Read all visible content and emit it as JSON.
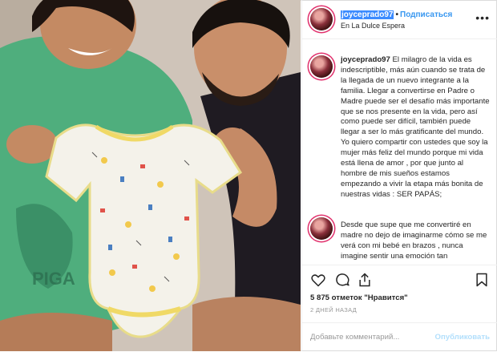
{
  "header": {
    "username": "joyceprado97",
    "separator": "•",
    "follow_label": "Подписаться",
    "location": "En La Dulce Espera",
    "more_icon": "more-horizontal-icon"
  },
  "caption": {
    "username": "joyceprado97",
    "lines": [
      "El milagro de la vida es indescriptible, más aún cuando se trata de la llegada de un nuevo integrante a la familia. Llegar a convertirse en Padre o Madre puede ser el desafío más importante que se nos presente en la vida, pero así como puede ser difícil, también puede llegar a ser lo más gratificante del mundo.",
      "Yo quiero compartir con ustedes que soy la mujer más feliz del mundo porque mi vida está llena de amor , por que junto al hombre de mis sueños estamos empezando a vivir la etapa más bonita de nuestras vidas : SER PAPÁS;",
      "Desde que supe que me convertiré en madre no dejo de imaginarme cómo se me verá con mi bebé en brazos , nunca imagine sentir una emoción tan"
    ]
  },
  "actions": {
    "like_icon": "heart-icon",
    "comment_icon": "comment-icon",
    "share_icon": "share-icon",
    "save_icon": "bookmark-icon"
  },
  "likes": "5 875 отметок \"Нравится\"",
  "date": "2 ДНЕЙ НАЗАД",
  "add_comment": {
    "placeholder": "Добавьте комментарий...",
    "post_label": "Опубликовать"
  },
  "colors": {
    "accent": "#3897f0",
    "selection": "#3b8bff",
    "post_disabled": "#b2dffc",
    "story_ring": "#e1306c"
  }
}
